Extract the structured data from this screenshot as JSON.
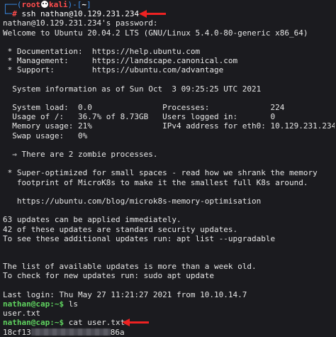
{
  "prompt": {
    "frame_top_left": "┌──(",
    "user": "root",
    "host": "kali",
    "frame_mid": ")-[",
    "path": "~",
    "frame_end": "]",
    "frame_bottom": "└─",
    "symbol": "#"
  },
  "command_ssh": "ssh nathan@10.129.231.234",
  "lines": {
    "password": "nathan@10.129.231.234's password:",
    "welcome": "Welcome to Ubuntu 20.04.2 LTS (GNU/Linux 5.4.0-80-generic x86_64)",
    "doc": " * Documentation:  https://help.ubuntu.com",
    "mgmt": " * Management:     https://landscape.canonical.com",
    "support": " * Support:        https://ubuntu.com/advantage",
    "sysinfo": "  System information as of Sun Oct  3 09:25:25 UTC 2021",
    "load": "  System load:  0.0               Processes:             224",
    "usage": "  Usage of /:   36.7% of 8.73GB   Users logged in:       0",
    "memory": "  Memory usage: 21%               IPv4 address for eth0: 10.129.231.234",
    "swap": "  Swap usage:   0%",
    "zombie": "  ⇒ There are 2 zombie processes.",
    "super1": " * Super-optimized for small spaces - read how we shrank the memory",
    "super2": "   footprint of MicroK8s to make it the smallest full K8s around.",
    "blog": "   https://ubuntu.com/blog/microk8s-memory-optimisation",
    "updates1": "63 updates can be applied immediately.",
    "updates2": "42 of these updates are standard security updates.",
    "updates3": "To see these additional updates run: apt list --upgradable",
    "old1": "The list of available updates is more than a week old.",
    "old2": "To check for new updates run: sudo apt update",
    "lastlogin": "Last login: Thu May 27 11:21:27 2021 from 10.10.14.7",
    "usertxt": "user.txt",
    "flag_start": "18cf13",
    "flag_end": "86a"
  },
  "shell_prompt": "nathan@cap:~$",
  "cmd_ls": "ls",
  "cmd_cat": "cat user.txt",
  "colors": {
    "background": "#1b1b1f",
    "prompt_blue": "#3b8eea",
    "root_red": "#ff4d4d",
    "shell_green": "#5fd35f",
    "arrow_red": "#ee2222"
  }
}
